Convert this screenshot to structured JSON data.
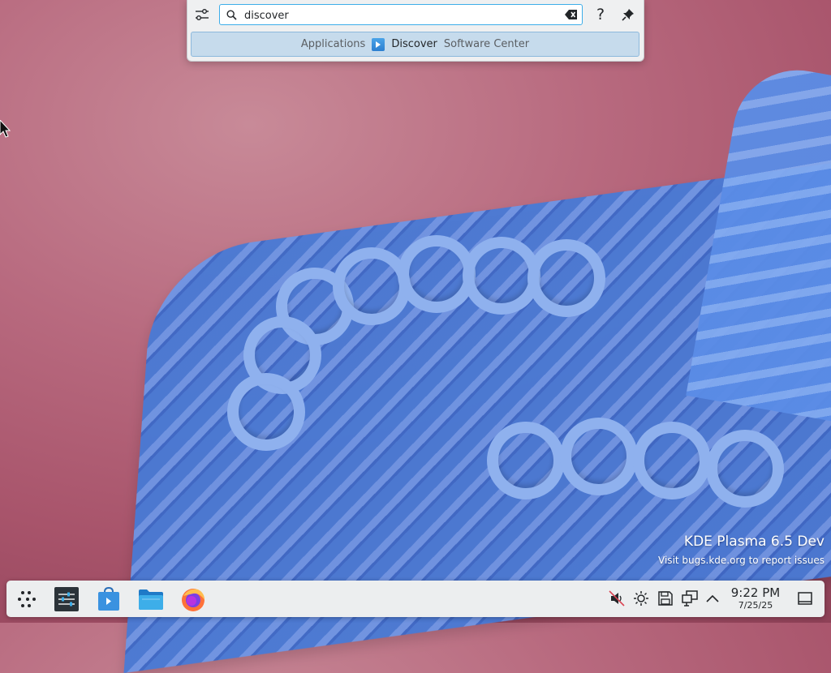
{
  "krunner": {
    "query": "discover",
    "help_label": "?",
    "result": {
      "category": "Applications",
      "icon": "discover-icon",
      "name": "Discover",
      "subtitle": "Software Center"
    }
  },
  "watermark": {
    "title": "KDE Plasma 6.5 Dev",
    "subtitle": "Visit bugs.kde.org to report issues"
  },
  "taskbar": {
    "launchers": [
      {
        "name": "application-launcher",
        "icon": "kde-launcher-icon"
      },
      {
        "name": "system-settings",
        "icon": "settings-icon"
      },
      {
        "name": "discover",
        "icon": "discover-icon"
      },
      {
        "name": "dolphin",
        "icon": "folder-icon"
      },
      {
        "name": "firefox",
        "icon": "firefox-icon"
      }
    ],
    "tray": [
      "audio-muted-icon",
      "brightness-icon",
      "storage-icon",
      "network-icon",
      "expand-tray-icon"
    ]
  },
  "clock": {
    "time": "9:22 PM",
    "date": "7/25/25"
  },
  "colors": {
    "accent": "#3daee9",
    "panel": "#eceeef",
    "selection": "#c6dbec"
  }
}
